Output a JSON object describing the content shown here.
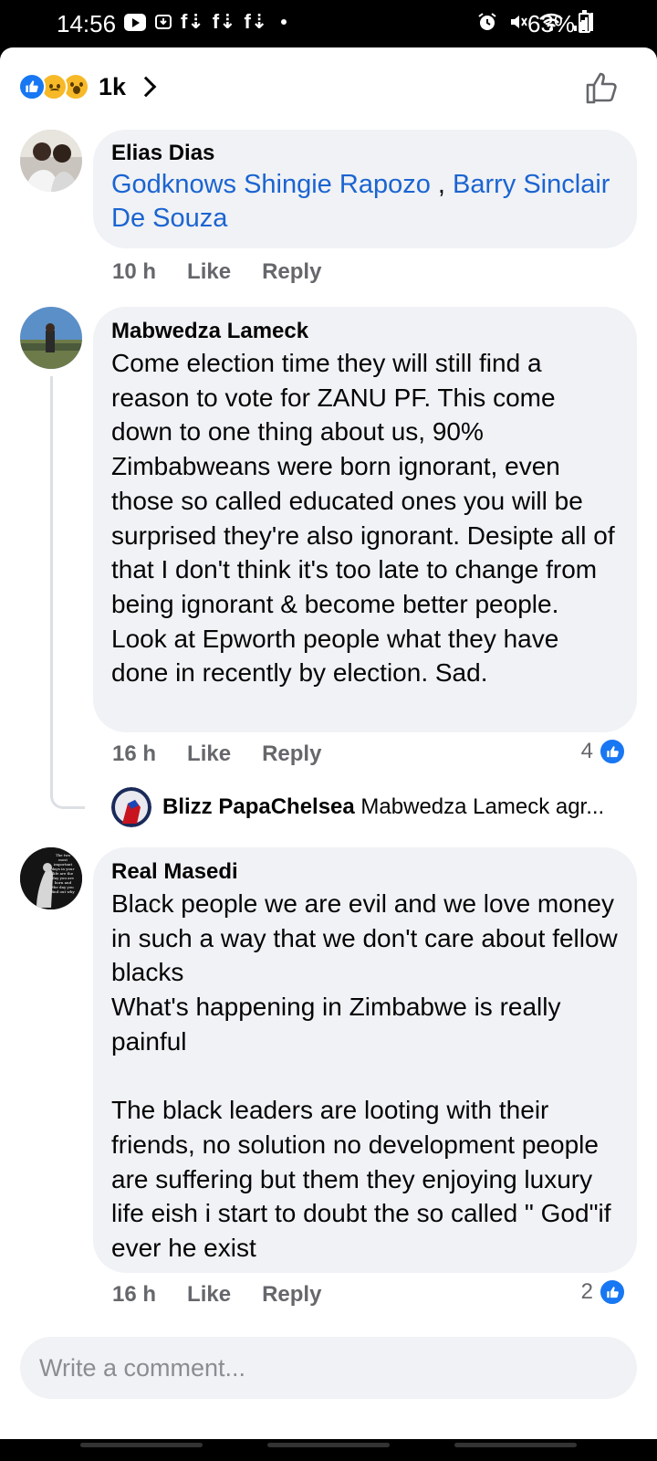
{
  "status_bar": {
    "time": "14:56",
    "battery": "63%",
    "battery_level": 0.63,
    "notification_glyphs": [
      "f⇣",
      "f⇣",
      "f⇣"
    ]
  },
  "reactions": {
    "count": "1k",
    "types": [
      "like",
      "sad",
      "wow"
    ]
  },
  "comments": [
    {
      "author": "Elias Dias",
      "tags": [
        "Godknows Shingie Rapozo",
        "Barry Sinclair De Souza"
      ],
      "tag_separator": " , ",
      "time": "10 h",
      "like_label": "Like",
      "reply_label": "Reply"
    },
    {
      "author": "Mabwedza Lameck",
      "text": "Come election time they will still find a reason to vote for ZANU PF. This come down to one thing about us, 90% Zimbabweans were born ignorant, even those so called educated ones you will be surprised they're also ignorant. Desipte all of that I don't think it's too late to change from being ignorant & become better people. Look at Epworth people what they have done in recently by election. Sad.",
      "time": "16 h",
      "like_label": "Like",
      "reply_label": "Reply",
      "likes": "4",
      "reply_preview": {
        "author": "Blizz PapaChelsea",
        "text": "Mabwedza Lameck agr..."
      }
    },
    {
      "author": "Real Masedi",
      "text": "Black people we are evil and we love money in such a way that we don't care about fellow blacks\nWhat's happening in Zimbabwe is really painful\n\nThe black leaders are looting with their friends, no solution no development people are suffering but them they enjoying luxury life eish i start to doubt the so called \" God\"if ever he exist",
      "time": "16 h",
      "like_label": "Like",
      "reply_label": "Reply",
      "likes": "2",
      "avatar_caption": "The two most important days in your life are the day you are born and the day you find out why"
    }
  ],
  "composer": {
    "placeholder": "Write a comment..."
  },
  "colors": {
    "accent": "#1877f2",
    "link": "#1b64d1",
    "bubble": "#f0f2f5",
    "meta": "#65676b"
  }
}
